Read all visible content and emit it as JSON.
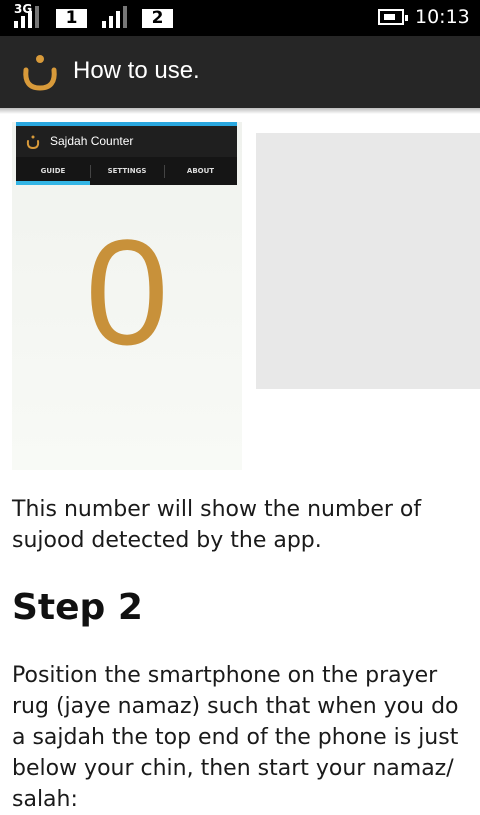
{
  "status_bar": {
    "network": "3G",
    "sim1": "1",
    "sim2": "2",
    "time": "10:13"
  },
  "action_bar": {
    "title": "How to use."
  },
  "screenshot": {
    "app_title": "Sajdah Counter",
    "tabs": [
      "GUIDE",
      "SETTINGS",
      "ABOUT"
    ],
    "selected_tab": "GUIDE",
    "counter": "0"
  },
  "content": {
    "paragraph1": "This number will show the number of sujood detected by the app.",
    "step_heading": "Step 2",
    "paragraph2": "Position the smartphone on the prayer rug (jaye namaz) such that when you do a sajdah the top end of the phone is just below your chin, then start your namaz/ salah:"
  },
  "colors": {
    "accent": "#33b5e5",
    "counter": "#c8913a",
    "action_bar": "#262626"
  }
}
